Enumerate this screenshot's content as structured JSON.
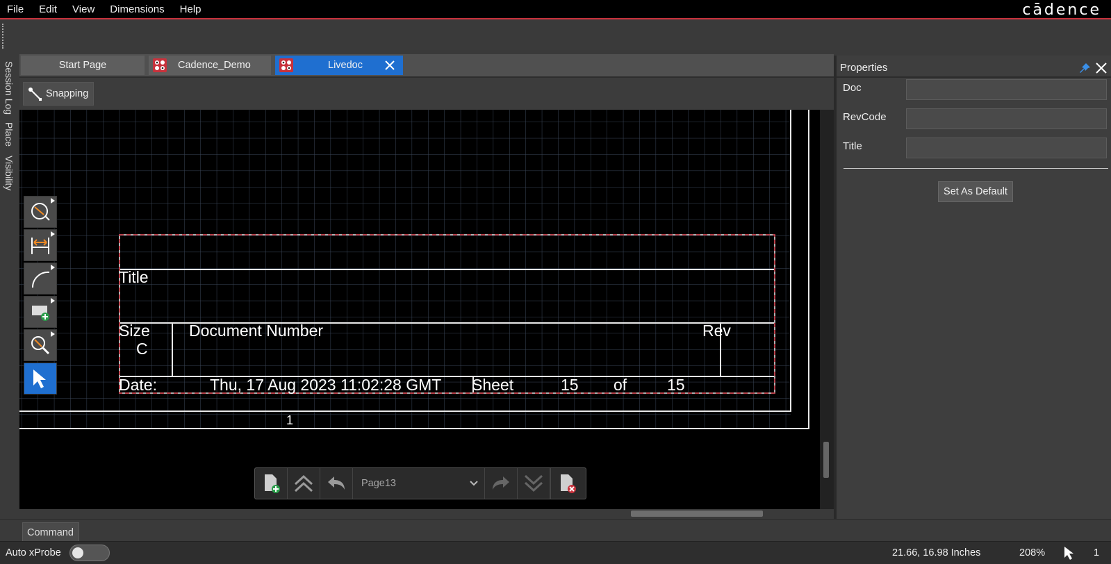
{
  "menu": {
    "items": [
      "File",
      "Edit",
      "View",
      "Dimensions",
      "Help"
    ],
    "brand": "cādence"
  },
  "side_tabs": [
    "Session Log",
    "Place",
    "Visibility"
  ],
  "doc_tabs": {
    "start": "Start Page",
    "demo": "Cadence_Demo",
    "live": "Livedoc"
  },
  "snapping": {
    "label": "Snapping"
  },
  "title_block": {
    "title_label": "Title",
    "size_label": "Size",
    "size_value": "C",
    "docnum_label": "Document Number",
    "rev_label": "Rev",
    "date_label": "Date:",
    "date_value": "Thu, 17 Aug 2023 11:02:28 GMT",
    "sheet_label": "Sheet",
    "sheet_value": "15",
    "of_label": "of",
    "of_value": "15",
    "border_zone": "1"
  },
  "page_nav": {
    "current": "Page13"
  },
  "properties": {
    "header": "Properties",
    "fields": [
      {
        "label": "Doc",
        "value": ""
      },
      {
        "label": "RevCode",
        "value": ""
      },
      {
        "label": "Title",
        "value": ""
      }
    ],
    "set_default": "Set As Default"
  },
  "command": {
    "label": "Command"
  },
  "status": {
    "xprobe": "Auto xProbe",
    "xprobe_on": false,
    "coords": "21.66, 16.98 Inches",
    "zoom": "208%",
    "count": "1"
  },
  "colors": {
    "accent": "#1f6fd0",
    "menu_underline": "#c8323c",
    "selection_dash": "#d0303c",
    "grid": "#3a4658"
  }
}
